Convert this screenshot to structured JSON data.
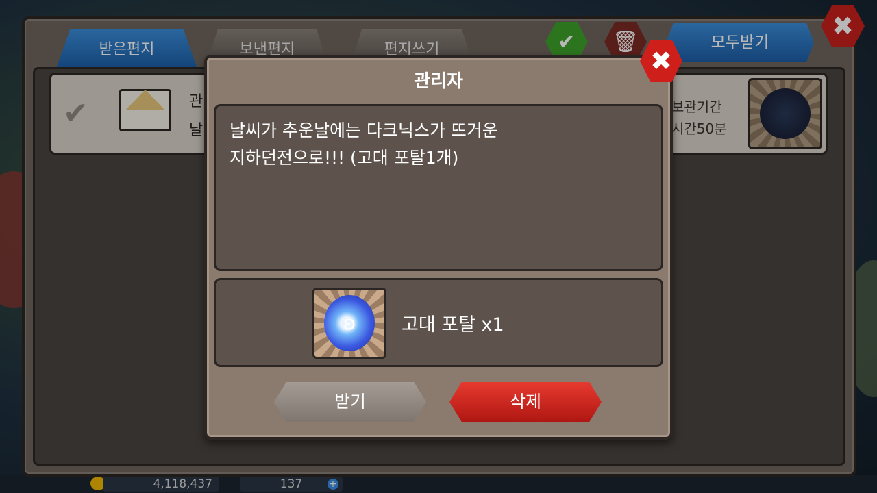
{
  "hud": {
    "gold": "4,118,437",
    "gems": "137",
    "gem_plus": "+"
  },
  "mailbox": {
    "tabs": [
      {
        "label": "받은편지"
      },
      {
        "label": "보낸편지"
      },
      {
        "label": "편지쓰기"
      }
    ],
    "receive_all_label": "모두받기",
    "select_all_icon": "check-icon",
    "delete_all_icon": "trash-icon",
    "close_icon": "close-icon",
    "mail_row": {
      "sender_partial": "관",
      "subject_partial": "날",
      "expire_line1": "보관기간",
      "expire_line2": "시간50분"
    }
  },
  "dialog": {
    "title": "관리자",
    "message_line1": "날씨가 추운날에는 다크닉스가 뜨거운",
    "message_line2": "지하던전으로!!! (고대 포탈1개)",
    "reward_label": "고대 포탈 x1",
    "receive_label": "받기",
    "delete_label": "삭제",
    "close_icon": "close-icon"
  },
  "colors": {
    "accent_blue": "#2a78c8",
    "delete_red": "#c91d17",
    "confirm_green": "#3fa12b",
    "panel_brown": "#8b7b6e"
  }
}
